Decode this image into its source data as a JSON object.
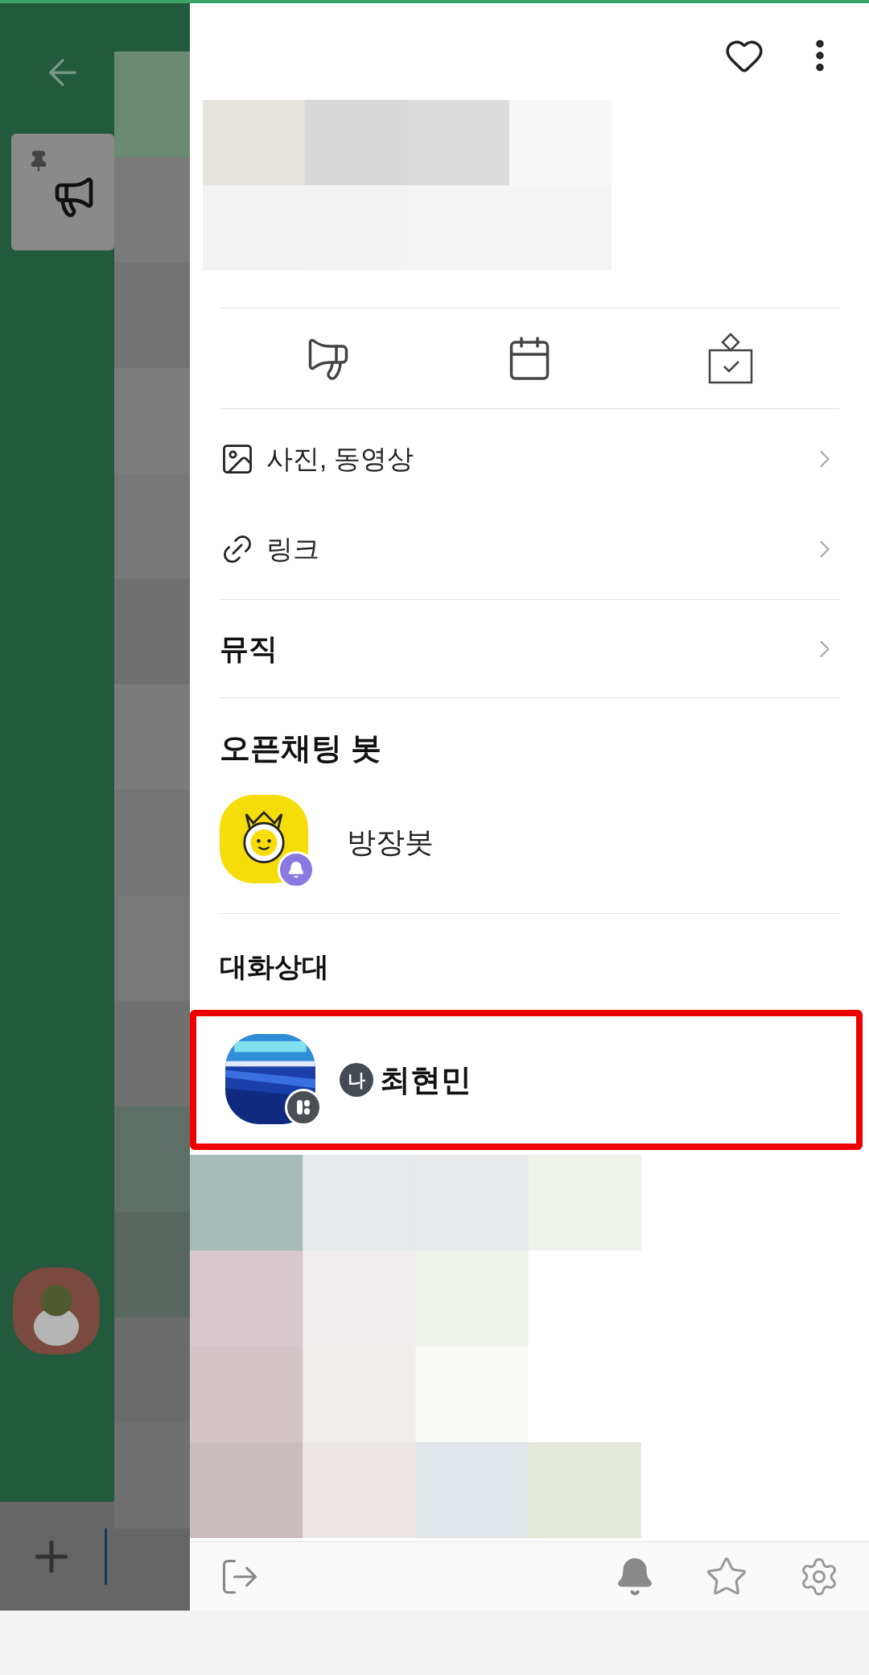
{
  "menu": [
    {
      "label": "사진, 동영상"
    },
    {
      "label": "링크",
      "kind": "link"
    }
  ],
  "music": {
    "label": "뮤직"
  },
  "bot_section": {
    "title": "오픈채팅 봇",
    "bots": [
      {
        "name": "방장봇"
      }
    ]
  },
  "members_section": {
    "title": "대화상대",
    "members": [
      {
        "badge": "나",
        "name": "최현민",
        "highlighted": true
      }
    ]
  }
}
